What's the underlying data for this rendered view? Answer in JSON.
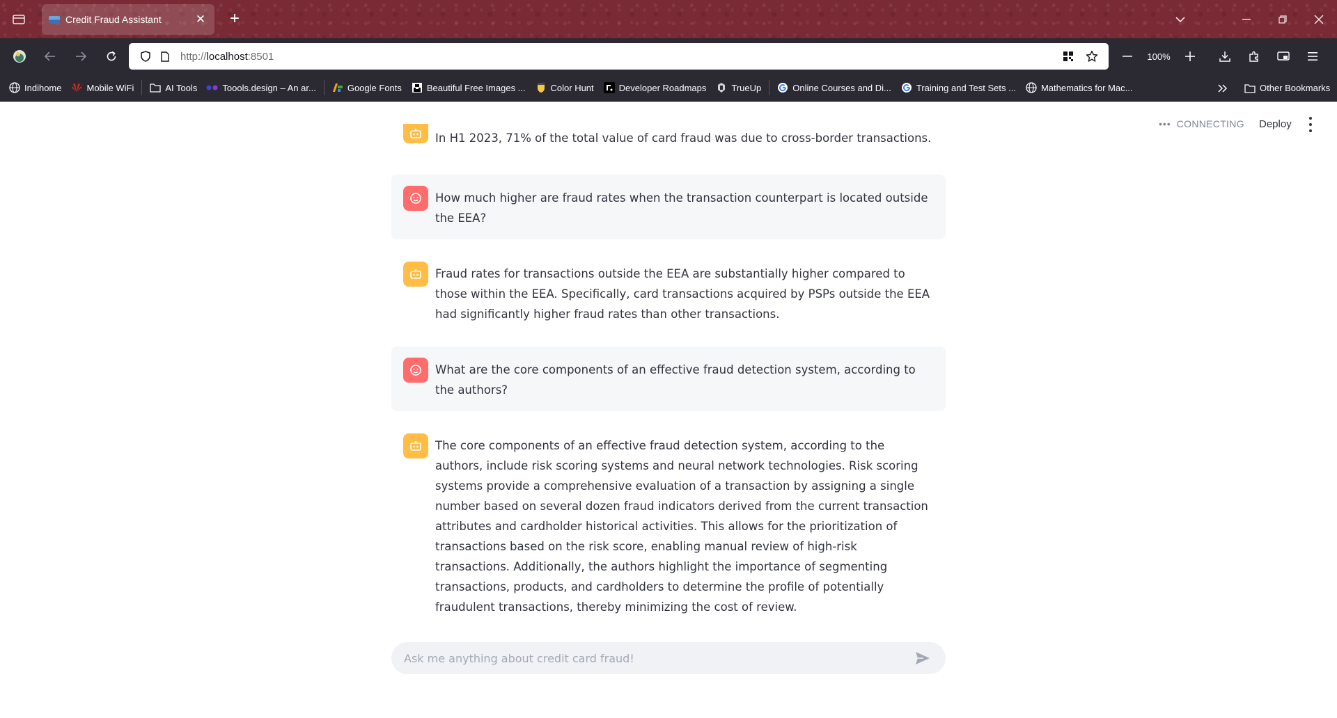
{
  "browser": {
    "tab": {
      "title": "Credit Fraud Assistant"
    },
    "url": {
      "protocol": "http://",
      "host": "localhost",
      "port": ":8501"
    },
    "zoom": "100%",
    "bookmarks": [
      {
        "label": "Indihome",
        "icon": "globe-icon"
      },
      {
        "label": "Mobile WiFi",
        "icon": "huawei-icon"
      },
      {
        "label": "AI Tools",
        "icon": "folder-icon"
      },
      {
        "label": "Toools.design – An ar...",
        "icon": "dots-icon"
      },
      {
        "label": "Google Fonts",
        "icon": "google-fonts-icon"
      },
      {
        "label": "Beautiful Free Images ...",
        "icon": "unsplash-icon"
      },
      {
        "label": "Color Hunt",
        "icon": "colorhunt-icon"
      },
      {
        "label": "Developer Roadmaps",
        "icon": "roadmap-icon"
      },
      {
        "label": "TrueUp",
        "icon": "trueup-icon"
      },
      {
        "label": "Online Courses and Di...",
        "icon": "google-icon"
      },
      {
        "label": "Training and Test Sets ...",
        "icon": "google-icon"
      },
      {
        "label": "Mathematics for Mac...",
        "icon": "globe-icon"
      }
    ],
    "other_bookmarks": "Other Bookmarks"
  },
  "app": {
    "status": "CONNECTING",
    "deploy": "Deploy",
    "messages": [
      {
        "role": "assistant",
        "text": "In H1 2023, 71% of the total value of card fraud was due to cross-border transactions."
      },
      {
        "role": "user",
        "text": "How much higher are fraud rates when the transaction counterpart is located outside the EEA?"
      },
      {
        "role": "assistant",
        "text": "Fraud rates for transactions outside the EEA are substantially higher compared to those within the EEA. Specifically, card transactions acquired by PSPs outside the EEA had significantly higher fraud rates than other transactions."
      },
      {
        "role": "user",
        "text": "What are the core components of an effective fraud detection system, according to the authors?"
      },
      {
        "role": "assistant",
        "text": "The core components of an effective fraud detection system, according to the authors, include risk scoring systems and neural network technologies. Risk scoring systems provide a comprehensive evaluation of a transaction by assigning a single number based on several dozen fraud indicators derived from the current transaction attributes and cardholder historical activities. This allows for the prioritization of transactions based on the risk score, enabling manual review of high-risk transactions. Additionally, the authors highlight the importance of segmenting transactions, products, and cardholders to determine the profile of potentially fraudulent transactions, thereby minimizing the cost of review."
      }
    ],
    "chat_input": {
      "placeholder": "Ask me anything about credit card fraud!",
      "value": ""
    }
  },
  "colors": {
    "titlebar": "#7a2a34",
    "toolbar": "#2b2a33",
    "assistant_avatar": "#ffbd45",
    "user_avatar": "#ff6c6c",
    "user_bubble": "#f6f7f9",
    "text": "#31333f"
  }
}
